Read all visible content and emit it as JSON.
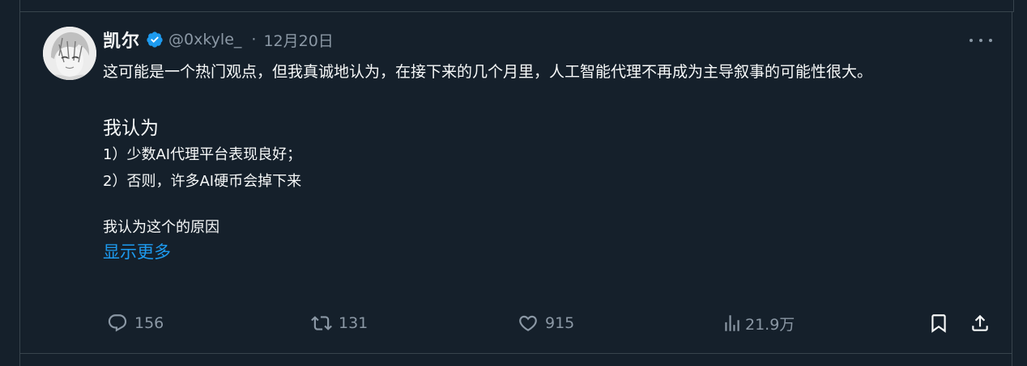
{
  "author": {
    "display_name": "凯尔",
    "handle": "@0xkyle_",
    "separator": "·",
    "date": "12月20日",
    "verified_color": "#1d9bf0"
  },
  "tweet": {
    "paragraph1": "这可能是一个热门观点，但我真诚地认为，在接下来的几个月里，人工智能代理不再成为主导叙事的可能性很大。",
    "heading": "我认为",
    "item1": "1）少数AI代理平台表现良好；",
    "item2": "2）否则，许多AI硬币会掉下来",
    "reason": "我认为这个的原因",
    "show_more": "显示更多"
  },
  "actions": {
    "replies": "156",
    "retweets": "131",
    "likes": "915",
    "views": "21.9万"
  },
  "icons": {
    "reply": "reply-icon",
    "retweet": "retweet-icon",
    "like": "heart-icon",
    "views": "views-icon",
    "bookmark": "bookmark-icon",
    "share": "share-icon",
    "more": "more-icon"
  },
  "colors": {
    "background": "#15202b",
    "text": "#f7f9f9",
    "muted": "#8b98a5",
    "accent": "#1d9bf0",
    "border": "#38444d"
  }
}
